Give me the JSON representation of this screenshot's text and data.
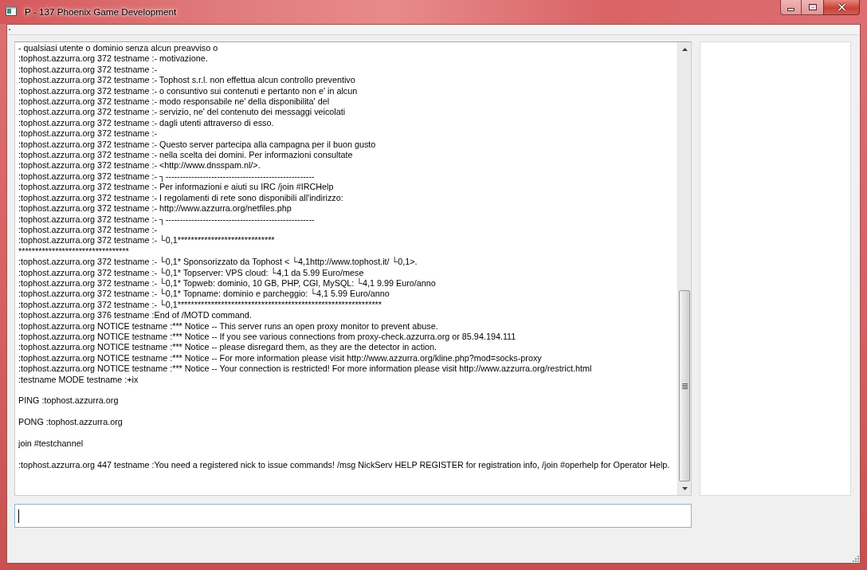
{
  "window": {
    "title": "P - 137 Phoenix Game Development"
  },
  "log": {
    "blocks": [
      [
        "- qualsiasi utente o dominio senza alcun preavviso o",
        ":tophost.azzurra.org 372 testname :- motivazione.",
        ":tophost.azzurra.org 372 testname :-",
        ":tophost.azzurra.org 372 testname :- Tophost s.r.l. non effettua alcun controllo preventivo",
        ":tophost.azzurra.org 372 testname :- o consuntivo sui contenuti e pertanto non e' in alcun",
        ":tophost.azzurra.org 372 testname :- modo responsabile ne' della disponibilita' del",
        ":tophost.azzurra.org 372 testname :- servizio, ne' del contenuto dei messaggi veicolati",
        ":tophost.azzurra.org 372 testname :- dagli utenti attraverso di esso.",
        ":tophost.azzurra.org 372 testname :-",
        ":tophost.azzurra.org 372 testname :- Questo server partecipa alla campagna per il buon gusto",
        ":tophost.azzurra.org 372 testname :- nella scelta dei domini. Per informazioni consultate",
        ":tophost.azzurra.org 372 testname :- <http://www.dnsspam.nl/>.",
        ":tophost.azzurra.org 372 testname :- ┐----------------------------------------------------",
        ":tophost.azzurra.org 372 testname :- Per informazioni e aiuti su IRC /join #IRCHelp",
        ":tophost.azzurra.org 372 testname :- I regolamenti di rete sono disponibili all'indirizzo:",
        ":tophost.azzurra.org 372 testname :- http://www.azzurra.org/netfiles.php",
        ":tophost.azzurra.org 372 testname :- ┐----------------------------------------------------",
        ":tophost.azzurra.org 372 testname :-",
        ":tophost.azzurra.org 372 testname :- └0,1*****************************",
        "*********************************",
        ":tophost.azzurra.org 372 testname :- └0,1* Sponsorizzato da Tophost < └4,1http://www.tophost.it/ └0,1>.",
        ":tophost.azzurra.org 372 testname :- └0,1* Topserver: VPS cloud: └4,1 da 5.99 Euro/mese",
        ":tophost.azzurra.org 372 testname :- └0,1* Topweb: dominio, 10 GB, PHP, CGI, MySQL: └4,1 9.99 Euro/anno",
        ":tophost.azzurra.org 372 testname :- └0,1* Topname: dominio e parcheggio: └4,1 5.99 Euro/anno",
        ":tophost.azzurra.org 372 testname :- └0,1*************************************************************",
        ":tophost.azzurra.org 376 testname :End of /MOTD command.",
        ":tophost.azzurra.org NOTICE testname :*** Notice -- This server runs an open proxy monitor to prevent abuse.",
        ":tophost.azzurra.org NOTICE testname :*** Notice -- If you see various connections from proxy-check.azzurra.org or 85.94.194.111",
        ":tophost.azzurra.org NOTICE testname :*** Notice -- please disregard them, as they are the detector in action.",
        ":tophost.azzurra.org NOTICE testname :*** Notice -- For more information please visit http://www.azzurra.org/kline.php?mod=socks-proxy",
        ":tophost.azzurra.org NOTICE testname :*** Notice -- Your connection is restricted! For more information please visit http://www.azzurra.org/restrict.html",
        ":testname MODE testname :+ix"
      ],
      [
        "PING :tophost.azzurra.org"
      ],
      [
        "PONG :tophost.azzurra.org"
      ],
      [
        "join #testchannel"
      ],
      [
        ":tophost.azzurra.org 447 testname :You need a registered nick to issue commands! /msg NickServ HELP REGISTER for registration info, /join #operhelp for Operator Help."
      ]
    ]
  },
  "input": {
    "focused": true
  }
}
